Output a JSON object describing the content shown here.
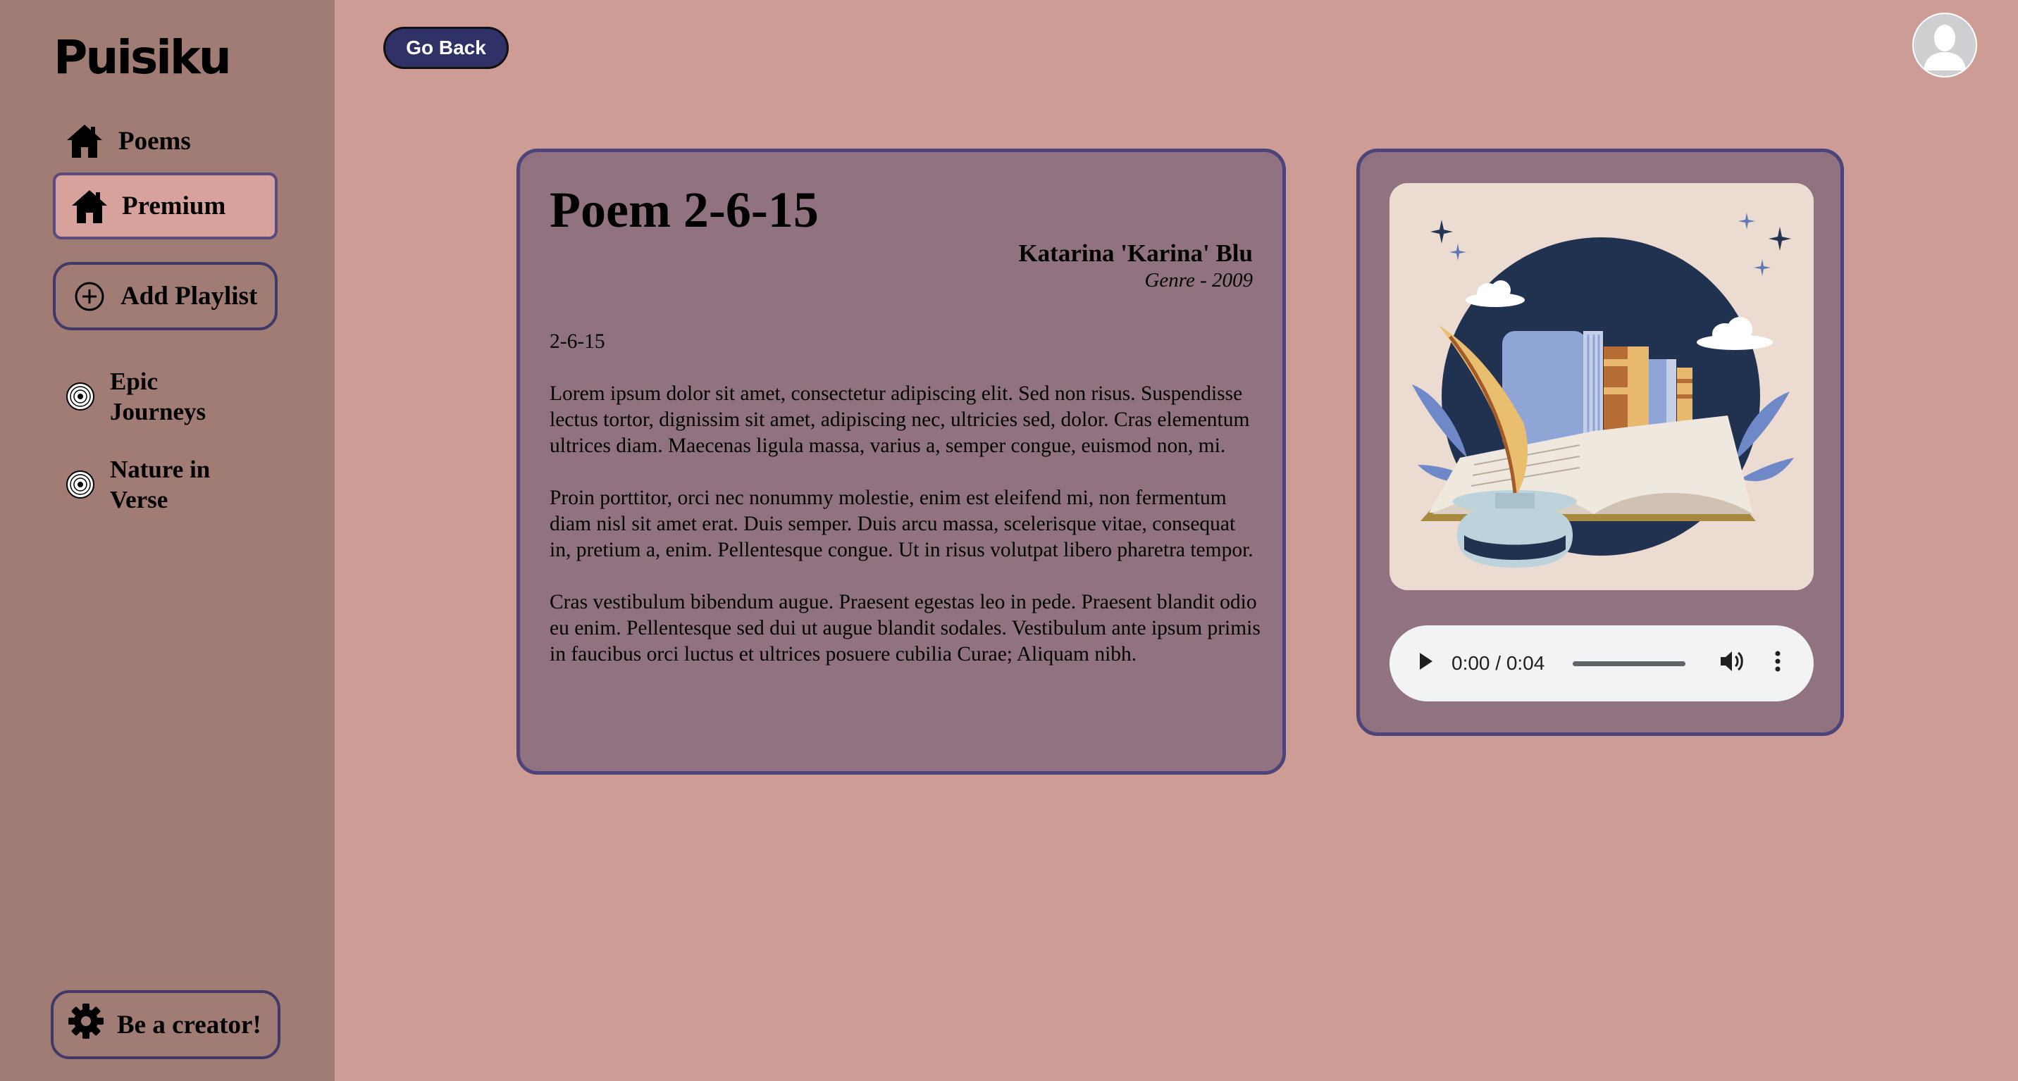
{
  "app": {
    "brand": "Puisiku"
  },
  "sidebar": {
    "nav": [
      {
        "label": "Poems",
        "icon": "home-icon"
      },
      {
        "label": "Premium",
        "icon": "home-icon"
      }
    ],
    "add_playlist": {
      "label": "Add Playlist",
      "icon": "plus-circle-icon"
    },
    "playlists": [
      {
        "label": "Epic Journeys",
        "icon": "vinyl-disc-icon"
      },
      {
        "label": "Nature in Verse",
        "icon": "vinyl-disc-icon"
      }
    ],
    "creator": {
      "label": "Be a creator!",
      "icon": "gear-icon"
    }
  },
  "header": {
    "back_label": "Go Back",
    "avatar_icon": "user-avatar-icon"
  },
  "poem": {
    "title": "Poem 2-6-15",
    "author": "Katarina 'Karina' Blu",
    "genre_line": "Genre - 2009",
    "paragraphs": [
      "2-6-15",
      "Lorem ipsum dolor sit amet, consectetur adipiscing elit. Sed non risus. Suspendisse lectus tortor, dignissim sit amet, adipiscing nec, ultricies sed, dolor. Cras elementum ultrices diam. Maecenas ligula massa, varius a, semper congue, euismod non, mi.",
      "Proin porttitor, orci nec nonummy molestie, enim est eleifend mi, non fermentum diam nisl sit amet erat. Duis semper. Duis arcu massa, scelerisque vitae, consequat in, pretium a, enim. Pellentesque congue. Ut in risus volutpat libero pharetra tempor.",
      "Cras vestibulum bibendum augue. Praesent egestas leo in pede. Praesent blandit odio eu enim. Pellentesque sed dui ut augue blandit sodales. Vestibulum ante ipsum primis in faucibus orci luctus et ultrices posuere cubilia Curae; Aliquam nibh."
    ]
  },
  "media": {
    "cover_icon": "book-quill-illustration",
    "player": {
      "time": "0:00 / 0:04",
      "progress": 0,
      "icons": [
        "play-icon",
        "volume-icon",
        "more-vert-icon"
      ]
    }
  },
  "colors": {
    "page_bg": "#cc9c95",
    "sidebar_bg": "#a17c74",
    "card_bg": "#917281",
    "card_border": "#4d4479",
    "go_back_bg": "#2f3167",
    "premium_bg": "#d7a29c"
  }
}
